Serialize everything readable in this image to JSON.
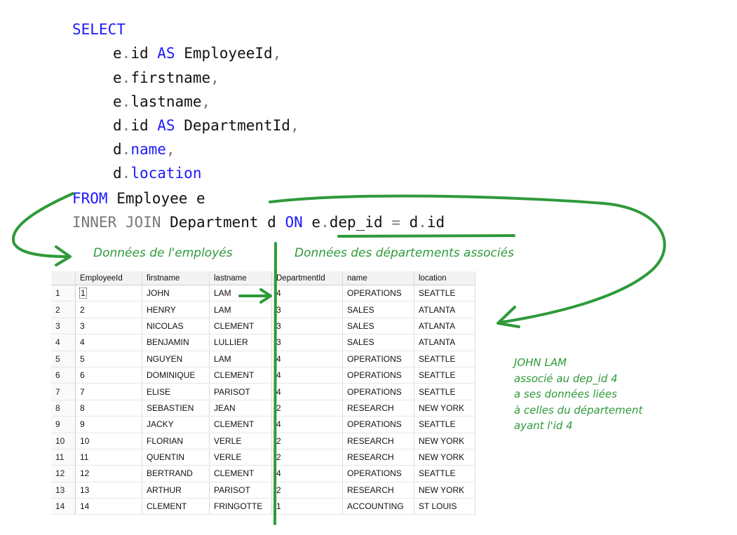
{
  "sql": {
    "select": "SELECT",
    "lines": [
      {
        "t": "e",
        "dot": ".",
        "f": "id",
        "as": "AS",
        "alias": "EmployeeId",
        "comma": ","
      },
      {
        "t": "e",
        "dot": ".",
        "f": "firstname",
        "comma": ","
      },
      {
        "t": "e",
        "dot": ".",
        "f": "lastname",
        "comma": ","
      },
      {
        "t": "d",
        "dot": ".",
        "f": "id",
        "as": "AS",
        "alias": "DepartmentId",
        "comma": ","
      },
      {
        "t": "d",
        "dot": ".",
        "f": "name",
        "comma": ","
      },
      {
        "t": "d",
        "dot": ".",
        "f": "location"
      }
    ],
    "from_kw": "FROM",
    "from_table": "Employee e",
    "join_kw": "INNER JOIN",
    "join_table": "Department d",
    "on_kw": "ON",
    "cond_left_t": "e",
    "cond_left_f": "dep_id",
    "cond_eq": "=",
    "cond_right_t": "d",
    "cond_right_f": "id"
  },
  "annotations": {
    "employee_header": "Données de l'employés",
    "department_header": "Données des départements associés",
    "note": [
      "JOHN LAM",
      "associé au dep_id 4",
      "a ses données liées",
      "à celles du département",
      "ayant l'id 4"
    ]
  },
  "results": {
    "columns": [
      "EmployeeId",
      "firstname",
      "lastname",
      "DepartmentId",
      "name",
      "location"
    ],
    "rows": [
      [
        "1",
        "1",
        "JOHN",
        "LAM",
        "4",
        "OPERATIONS",
        "SEATTLE"
      ],
      [
        "2",
        "2",
        "HENRY",
        "LAM",
        "3",
        "SALES",
        "ATLANTA"
      ],
      [
        "3",
        "3",
        "NICOLAS",
        "CLEMENT",
        "3",
        "SALES",
        "ATLANTA"
      ],
      [
        "4",
        "4",
        "BENJAMIN",
        "LULLIER",
        "3",
        "SALES",
        "ATLANTA"
      ],
      [
        "5",
        "5",
        "NGUYEN",
        "LAM",
        "4",
        "OPERATIONS",
        "SEATTLE"
      ],
      [
        "6",
        "6",
        "DOMINIQUE",
        "CLEMENT",
        "4",
        "OPERATIONS",
        "SEATTLE"
      ],
      [
        "7",
        "7",
        "ELISE",
        "PARISOT",
        "4",
        "OPERATIONS",
        "SEATTLE"
      ],
      [
        "8",
        "8",
        "SEBASTIEN",
        "JEAN",
        "2",
        "RESEARCH",
        "NEW YORK"
      ],
      [
        "9",
        "9",
        "JACKY",
        "CLEMENT",
        "4",
        "OPERATIONS",
        "SEATTLE"
      ],
      [
        "10",
        "10",
        "FLORIAN",
        "VERLE",
        "2",
        "RESEARCH",
        "NEW YORK"
      ],
      [
        "11",
        "11",
        "QUENTIN",
        "VERLE",
        "2",
        "RESEARCH",
        "NEW YORK"
      ],
      [
        "12",
        "12",
        "BERTRAND",
        "CLEMENT",
        "4",
        "OPERATIONS",
        "SEATTLE"
      ],
      [
        "13",
        "13",
        "ARTHUR",
        "PARISOT",
        "2",
        "RESEARCH",
        "NEW YORK"
      ],
      [
        "14",
        "14",
        "CLEMENT",
        "FRINGOTTE",
        "1",
        "ACCOUNTING",
        "ST LOUIS"
      ]
    ]
  },
  "colors": {
    "keyword": "#1a1aff",
    "annotation": "#2e9a3a",
    "operator": "#777777"
  }
}
